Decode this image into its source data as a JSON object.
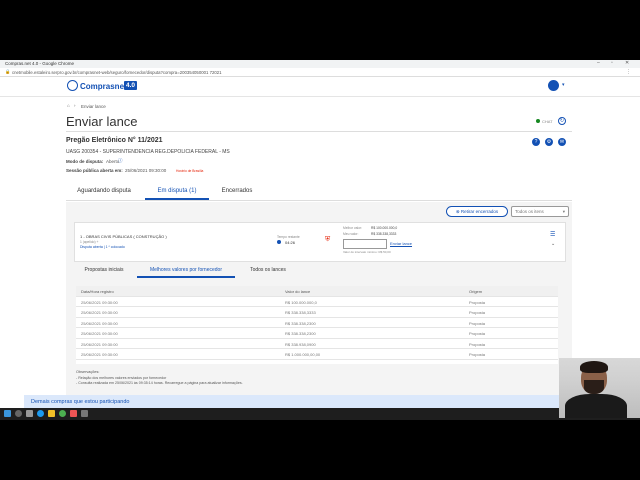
{
  "browser": {
    "window_title": "Compras.net 4.0 - Google Chrome",
    "url": "cnetmobile.estaleiro.serpro.gov.br/comprasnet-web/seguro/fornecedor/disputa?compra=200354050001 72021"
  },
  "app": {
    "logo_text": "Comprasnet",
    "logo_version": "4.0",
    "breadcrumb": "Enviar lance",
    "page_title": "Enviar lance",
    "chat_label": "CHAT"
  },
  "pregao": {
    "title": "Pregão Eletrônico N° 11/2021",
    "uasg": "UASG 200354 - SUPERINTENDENCIA REG.DEPOLICIA FEDERAL - MS",
    "modo_label": "Modo de disputa:",
    "modo_value": "Aberto",
    "sessao_label": "Sessão pública aberta em:",
    "sessao_value": "25/06/2021 09:30:00",
    "sessao_note": "Horário de Brasília"
  },
  "tabs": [
    "Aguardando disputa",
    "Em disputa (1)",
    "Encerrados"
  ],
  "filters": {
    "retirar_label": "Retirar encerrados",
    "select_value": "Todos os itens"
  },
  "item": {
    "title": "1 - OBRAS CIVIS PÚBLICAS ( CONSTRUÇÃO )",
    "subtitle": "1 (apelido) +",
    "status": "Disputa aberta | 1 º colocado",
    "tempo_label": "Tempo restante",
    "tempo_value": "04:26",
    "melhor_valor_label": "Melhor valor:",
    "melhor_valor": "R$ 100.000.000,0",
    "meu_valor_label": "Meu valor:",
    "meu_valor": "R$ 338.338,3333",
    "enviar_label": "Enviar lance",
    "note": "Valor do intervalo mínimo: R$ 50,00"
  },
  "subtabs": [
    "Propostas iniciais",
    "Melhores valores por fornecedor",
    "Todos os lances"
  ],
  "table": {
    "headers": [
      "Data/Hora registro",
      "Valor do lance",
      "Origem"
    ],
    "rows": [
      [
        "25/06/2021 09:30:00",
        "R$ 100.000.000,0",
        "Proposta"
      ],
      [
        "25/06/2021 09:30:00",
        "R$ 338.338,3333",
        "Proposta"
      ],
      [
        "25/06/2021 09:30:00",
        "R$ 338.338,2300",
        "Proposta"
      ],
      [
        "25/06/2021 09:30:00",
        "R$ 338.338,2300",
        "Proposta"
      ],
      [
        "25/06/2021 09:30:00",
        "R$ 338.938,0900",
        "Proposta"
      ],
      [
        "25/06/2021 09:30:00",
        "R$ 1.000.000,00,00",
        "Proposta"
      ]
    ]
  },
  "observacoes": {
    "title": "Observações:",
    "line1": "- Relação dos melhores valores enviados por fornecedor",
    "line2": "- Consulta realizada em 25/06/2021 às 09:35:14 horas. Recarregue a página para atualizar informações."
  },
  "bottom_banner": "Demais compras que estou participando",
  "colors": {
    "primary": "#1351b4",
    "danger": "#e52207"
  }
}
